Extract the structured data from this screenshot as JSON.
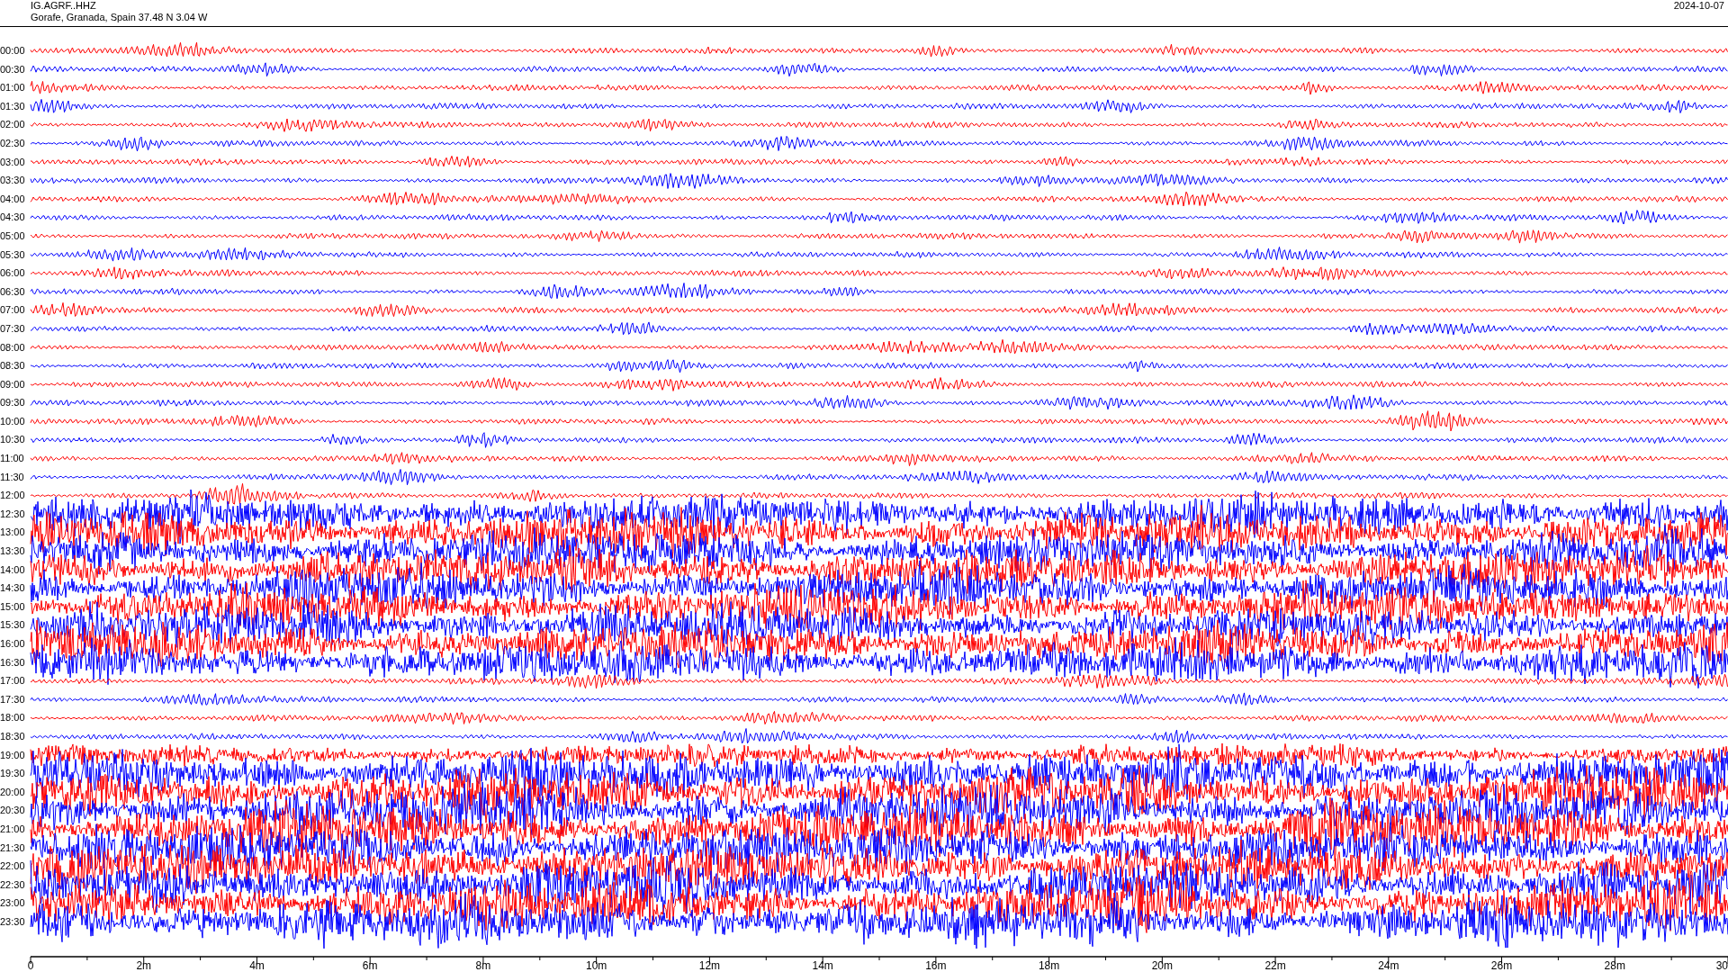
{
  "header": {
    "station": "IG.AGRF..HHZ",
    "location": "Gorafe, Granada, Spain  37.48 N 3.04 W",
    "date": "2024-10-07"
  },
  "traces": [
    {
      "label": "00:00",
      "color": "#ff0000"
    },
    {
      "label": "00:30",
      "color": "#0000ff"
    },
    {
      "label": "01:00",
      "color": "#ff0000"
    },
    {
      "label": "01:30",
      "color": "#0000ff"
    },
    {
      "label": "02:00",
      "color": "#ff0000"
    },
    {
      "label": "02:30",
      "color": "#0000ff"
    },
    {
      "label": "03:00",
      "color": "#ff0000"
    },
    {
      "label": "03:30",
      "color": "#0000ff"
    },
    {
      "label": "04:00",
      "color": "#ff0000"
    },
    {
      "label": "04:30",
      "color": "#0000ff"
    },
    {
      "label": "05:00",
      "color": "#ff0000"
    },
    {
      "label": "05:30",
      "color": "#0000ff"
    },
    {
      "label": "06:00",
      "color": "#ff0000"
    },
    {
      "label": "06:30",
      "color": "#0000ff"
    },
    {
      "label": "07:00",
      "color": "#ff0000"
    },
    {
      "label": "07:30",
      "color": "#0000ff"
    },
    {
      "label": "08:00",
      "color": "#ff0000"
    },
    {
      "label": "08:30",
      "color": "#0000ff"
    },
    {
      "label": "09:00",
      "color": "#ff0000"
    },
    {
      "label": "09:30",
      "color": "#0000ff"
    },
    {
      "label": "10:00",
      "color": "#ff0000"
    },
    {
      "label": "10:30",
      "color": "#0000ff"
    },
    {
      "label": "11:00",
      "color": "#ff0000"
    },
    {
      "label": "11:30",
      "color": "#0000ff"
    },
    {
      "label": "12:00",
      "color": "#ff0000"
    },
    {
      "label": "12:30",
      "color": "#0000ff"
    },
    {
      "label": "13:00",
      "color": "#ff0000"
    },
    {
      "label": "13:30",
      "color": "#0000ff"
    },
    {
      "label": "14:00",
      "color": "#ff0000"
    },
    {
      "label": "14:30",
      "color": "#0000ff"
    },
    {
      "label": "15:00",
      "color": "#ff0000"
    },
    {
      "label": "15:30",
      "color": "#0000ff"
    },
    {
      "label": "16:00",
      "color": "#ff0000"
    },
    {
      "label": "16:30",
      "color": "#0000ff"
    },
    {
      "label": "17:00",
      "color": "#ff0000"
    },
    {
      "label": "17:30",
      "color": "#0000ff"
    },
    {
      "label": "18:00",
      "color": "#ff0000"
    },
    {
      "label": "18:30",
      "color": "#0000ff"
    },
    {
      "label": "19:00",
      "color": "#ff0000"
    },
    {
      "label": "19:30",
      "color": "#0000ff"
    },
    {
      "label": "20:00",
      "color": "#ff0000"
    },
    {
      "label": "20:30",
      "color": "#0000ff"
    },
    {
      "label": "21:00",
      "color": "#ff0000"
    },
    {
      "label": "21:30",
      "color": "#0000ff"
    },
    {
      "label": "22:00",
      "color": "#ff0000"
    },
    {
      "label": "22:30",
      "color": "#0000ff"
    },
    {
      "label": "23:00",
      "color": "#ff0000"
    },
    {
      "label": "23:30",
      "color": "#0000ff"
    }
  ],
  "x_axis": {
    "labels": [
      "0",
      "2m",
      "4m",
      "6m",
      "8m",
      "10m",
      "12m",
      "14m",
      "16m",
      "18m",
      "20m",
      "22m",
      "24m",
      "26m",
      "28m",
      "30"
    ]
  }
}
